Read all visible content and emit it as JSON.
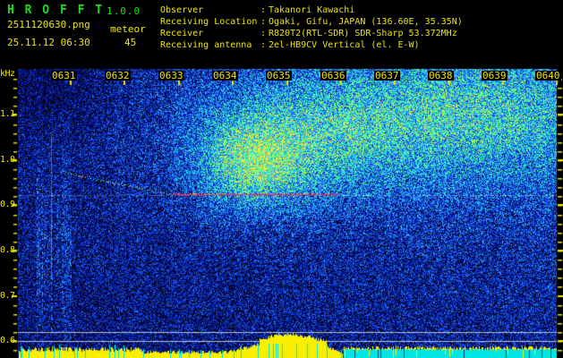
{
  "app": {
    "title": "H R O F F T",
    "version": "1.0.0",
    "filename": "2511120630.png",
    "mode": "meteor",
    "datetime": "25.11.12 06:30",
    "count": "45"
  },
  "info": {
    "separator": ":",
    "rows": [
      {
        "label": "Observer",
        "value": "Takanori Kawachi"
      },
      {
        "label": "Receiving Location",
        "value": "Ogaki, Gifu, JAPAN (136.60E, 35.35N)"
      },
      {
        "label": "Receiver",
        "value": "R820T2(RTL-SDR) SDR-Sharp 53.372MHz"
      },
      {
        "label": "Receiving antenna",
        "value": "2el-HB9CV Vertical (el. E-W)"
      }
    ]
  },
  "chart_data": {
    "type": "heatmap",
    "title": "HROFFT meteor radio observation spectrogram",
    "ylabel": "kHz",
    "x_ticks": [
      "0631",
      "0632",
      "0633",
      "0634",
      "0635",
      "0636",
      "0637",
      "0638",
      "0639",
      "0640"
    ],
    "y_ticks": [
      "1.1",
      "1.0",
      "0.9",
      "0.8",
      "0.7",
      "0.6"
    ],
    "x_range_hhmm": [
      "0630",
      "0640"
    ],
    "y_range_khz": [
      0.56,
      1.2
    ],
    "grid": false,
    "legend": "none",
    "carrier_line_khz": 0.92,
    "threshold_lines_khz": [
      0.62,
      0.6
    ],
    "features": [
      "speckled blue noise background, brighter toward upper right",
      "broad bright cyan-green scatter cloud from ~0633 to 0640 above 0.9 kHz",
      "strong green echo blob near 0634 around 0.95-1.05 kHz",
      "red carrier/doppler segment at ~0.92 kHz from ~0633 to ~0636",
      "faint gray carrier line at ~0.92 kHz across full width",
      "descending doppler trace from (0631, 0.97 kHz) to (0633, 0.92 kHz)",
      "two horizontal gray threshold lines near 0.62 and 0.60 kHz",
      "yellow signal-level bar graph along bottom edge, peaking near 0635",
      "solid cyan saturation band along bottom from ~0636 to 0640"
    ],
    "bottom_graph": {
      "yellow_bars": "signal level",
      "cyan_band": "continuous signal band (right half)",
      "cyan_spikes": "vertical cyan lines in left half"
    },
    "colors": {
      "text_yellow": "#ece400",
      "title_green": "#17e017",
      "noise_dark": "#03041e",
      "noise_blue": "#0c30c8",
      "noise_cyan": "#23ebdc",
      "noise_green": "#55fa82",
      "carrier_red": "#ff2855",
      "threshold_gray": "#c8cdd2",
      "level_yellow": "#f8ef00",
      "band_cyan": "#00e4e4"
    }
  }
}
